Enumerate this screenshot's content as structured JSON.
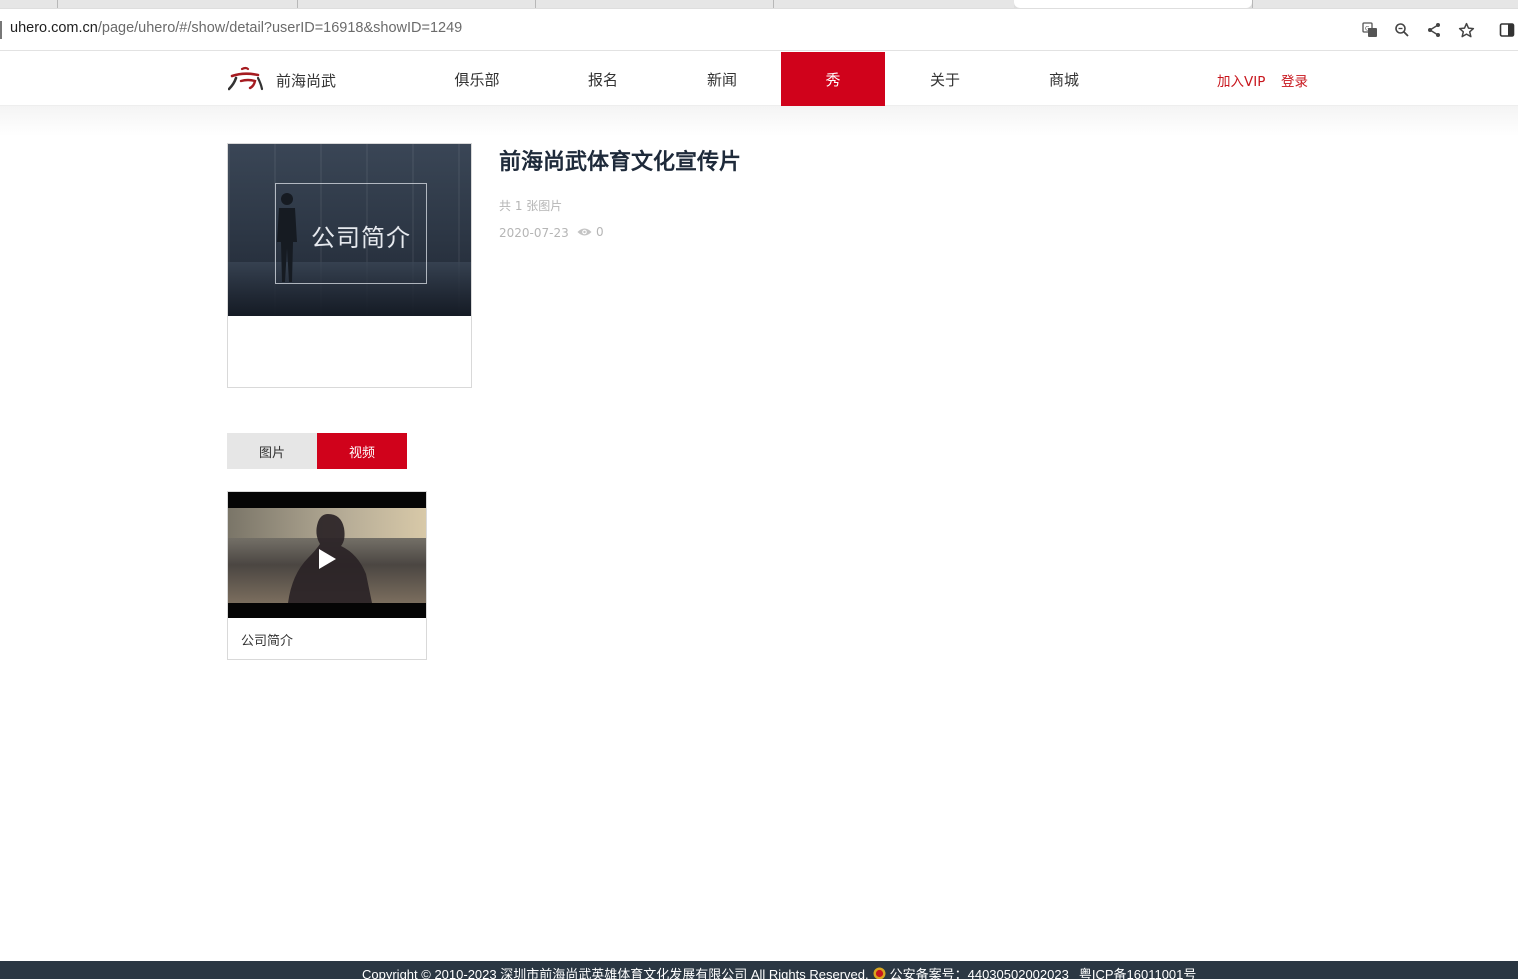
{
  "browser": {
    "url_host": "uhero.com.cn",
    "url_path": "/page/uhero/#/show/detail?userID=16918&showID=1249",
    "icons": [
      "translate-icon",
      "zoom-icon",
      "share-icon",
      "bookmark-star-icon",
      "side-panel-icon"
    ]
  },
  "header": {
    "brand": "前海尚武",
    "nav": [
      {
        "label": "俱乐部"
      },
      {
        "label": "报名"
      },
      {
        "label": "新闻"
      },
      {
        "label": "秀"
      },
      {
        "label": "关于"
      },
      {
        "label": "商城"
      }
    ],
    "active_nav": "秀",
    "vip_link": "加入VIP",
    "login_link": "登录",
    "accent_color": "#d0021b"
  },
  "show": {
    "cover_text": "公司简介",
    "title": "前海尚武体育文化宣传片",
    "count_text": "共 1 张图片",
    "date": "2020-07-23",
    "views": "0"
  },
  "tabs": {
    "images_label": "图片",
    "videos_label": "视频",
    "active": "视频"
  },
  "videos": [
    {
      "caption": "公司简介"
    }
  ],
  "footer": {
    "copyright": "Copyright © 2010-2023 深圳市前海尚武英雄体育文化发展有限公司 All Rights Reserved.",
    "police_record": "公安备案号：44030502002023",
    "icp": "粤ICP备16011001号"
  }
}
